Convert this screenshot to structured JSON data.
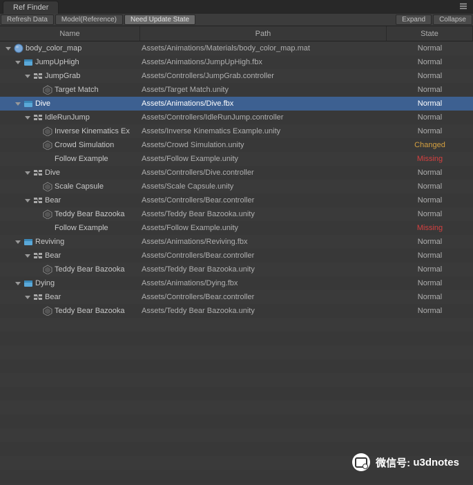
{
  "tabTitle": "Ref Finder",
  "toolbar": {
    "refresh": "Refresh Data",
    "model": "Model(Reference)",
    "needUpdate": "Need Update State",
    "expand": "Expand",
    "collapse": "Collapse"
  },
  "headers": {
    "name": "Name",
    "path": "Path",
    "state": "State"
  },
  "stateLabels": {
    "normal": "Normal",
    "changed": "Changed",
    "missing": "Missing"
  },
  "watermark": {
    "prefix": "微信号:",
    "id": "u3dnotes"
  },
  "rows": [
    {
      "depth": 0,
      "expanded": true,
      "icon": "material",
      "name": "body_color_map",
      "path": "Assets/Animations/Materials/body_color_map.mat",
      "state": "normal",
      "selected": false
    },
    {
      "depth": 1,
      "expanded": true,
      "icon": "fbx",
      "name": "JumpUpHigh",
      "path": "Assets/Animations/JumpUpHigh.fbx",
      "state": "normal",
      "selected": false
    },
    {
      "depth": 2,
      "expanded": true,
      "icon": "controller",
      "name": "JumpGrab",
      "path": "Assets/Controllers/JumpGrab.controller",
      "state": "normal",
      "selected": false
    },
    {
      "depth": 3,
      "expanded": false,
      "icon": "unity",
      "name": "Target Match",
      "path": "Assets/Target Match.unity",
      "state": "normal",
      "selected": false
    },
    {
      "depth": 1,
      "expanded": true,
      "icon": "fbx",
      "name": "Dive",
      "path": "Assets/Animations/Dive.fbx",
      "state": "normal",
      "selected": true
    },
    {
      "depth": 2,
      "expanded": true,
      "icon": "controller",
      "name": "IdleRunJump",
      "path": "Assets/Controllers/IdleRunJump.controller",
      "state": "normal",
      "selected": false
    },
    {
      "depth": 3,
      "expanded": false,
      "icon": "unity",
      "name": "Inverse Kinematics Ex",
      "path": "Assets/Inverse Kinematics Example.unity",
      "state": "normal",
      "selected": false
    },
    {
      "depth": 3,
      "expanded": false,
      "icon": "unity",
      "name": "Crowd Simulation",
      "path": "Assets/Crowd Simulation.unity",
      "state": "changed",
      "selected": false
    },
    {
      "depth": 3,
      "expanded": false,
      "icon": "none",
      "name": "Follow Example",
      "path": "Assets/Follow Example.unity",
      "state": "missing",
      "selected": false
    },
    {
      "depth": 2,
      "expanded": true,
      "icon": "controller",
      "name": "Dive",
      "path": "Assets/Controllers/Dive.controller",
      "state": "normal",
      "selected": false
    },
    {
      "depth": 3,
      "expanded": false,
      "icon": "unity",
      "name": "Scale Capsule",
      "path": "Assets/Scale Capsule.unity",
      "state": "normal",
      "selected": false
    },
    {
      "depth": 2,
      "expanded": true,
      "icon": "controller",
      "name": "Bear",
      "path": "Assets/Controllers/Bear.controller",
      "state": "normal",
      "selected": false
    },
    {
      "depth": 3,
      "expanded": false,
      "icon": "unity",
      "name": "Teddy Bear Bazooka",
      "path": "Assets/Teddy Bear Bazooka.unity",
      "state": "normal",
      "selected": false
    },
    {
      "depth": 3,
      "expanded": false,
      "icon": "none",
      "name": "Follow Example",
      "path": "Assets/Follow Example.unity",
      "state": "missing",
      "selected": false
    },
    {
      "depth": 1,
      "expanded": true,
      "icon": "fbx",
      "name": "Reviving",
      "path": "Assets/Animations/Reviving.fbx",
      "state": "normal",
      "selected": false
    },
    {
      "depth": 2,
      "expanded": true,
      "icon": "controller",
      "name": "Bear",
      "path": "Assets/Controllers/Bear.controller",
      "state": "normal",
      "selected": false
    },
    {
      "depth": 3,
      "expanded": false,
      "icon": "unity",
      "name": "Teddy Bear Bazooka",
      "path": "Assets/Teddy Bear Bazooka.unity",
      "state": "normal",
      "selected": false
    },
    {
      "depth": 1,
      "expanded": true,
      "icon": "fbx",
      "name": "Dying",
      "path": "Assets/Animations/Dying.fbx",
      "state": "normal",
      "selected": false
    },
    {
      "depth": 2,
      "expanded": true,
      "icon": "controller",
      "name": "Bear",
      "path": "Assets/Controllers/Bear.controller",
      "state": "normal",
      "selected": false
    },
    {
      "depth": 3,
      "expanded": false,
      "icon": "unity",
      "name": "Teddy Bear Bazooka",
      "path": "Assets/Teddy Bear Bazooka.unity",
      "state": "normal",
      "selected": false
    }
  ]
}
